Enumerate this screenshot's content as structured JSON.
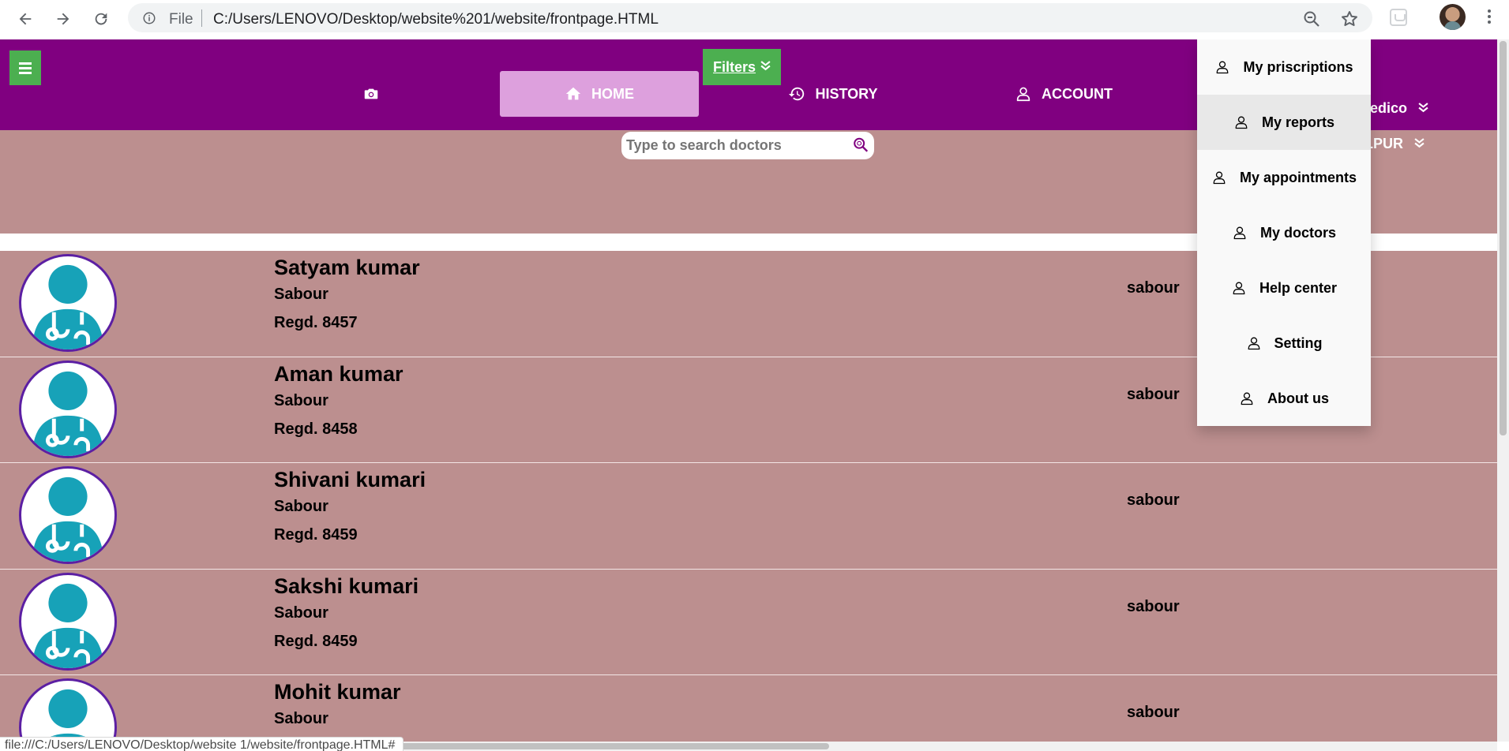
{
  "browser": {
    "scheme_label": "File",
    "url": "C:/Users/LENOVO/Desktop/website%201/website/frontpage.HTML",
    "status_url": "file:///C:/Users/LENOVO/Desktop/website 1/website/frontpage.HTML#",
    "icons": [
      "back-arrow-icon",
      "forward-arrow-icon",
      "reload-icon",
      "info-icon",
      "zoom-out-icon",
      "star-icon",
      "extension-icon",
      "avatar",
      "more-vert-icon"
    ]
  },
  "header": {
    "filters_label": "Filters",
    "nav": {
      "camera_icon": "camera-icon",
      "home_label": "HOME",
      "history_label": "HISTORY",
      "account_label": "ACCOUNT"
    },
    "side_medico": "edico",
    "side_city": "LPUR",
    "colors": {
      "bar": "#800080",
      "home_active": "#dda0dd",
      "green": "#4caf50"
    }
  },
  "search": {
    "placeholder": "Type to search doctors",
    "value": ""
  },
  "doctors": [
    {
      "name": "Satyam kumar",
      "place": "Sabour",
      "regd": "Regd. 8457",
      "location": "sabour"
    },
    {
      "name": "Aman kumar",
      "place": "Sabour",
      "regd": "Regd. 8458",
      "location": "sabour"
    },
    {
      "name": "Shivani kumari",
      "place": "Sabour",
      "regd": "Regd. 8459",
      "location": "sabour"
    },
    {
      "name": "Sakshi kumari",
      "place": "Sabour",
      "regd": "Regd. 8459",
      "location": "sabour"
    },
    {
      "name": "Mohit kumar",
      "place": "Sabour",
      "regd": "",
      "location": "sabour"
    }
  ],
  "account_menu": {
    "items": [
      {
        "label": "My priscriptions",
        "icon": "user-icon"
      },
      {
        "label": "My reports",
        "icon": "user-icon",
        "hovered": true
      },
      {
        "label": "My appointments",
        "icon": "user-icon"
      },
      {
        "label": "My doctors",
        "icon": "user-icon"
      },
      {
        "label": "Help center",
        "icon": "user-icon"
      },
      {
        "label": "Setting",
        "icon": "user-icon"
      },
      {
        "label": "About us",
        "icon": "user-icon"
      }
    ]
  },
  "colors": {
    "list_bg": "#bc8f8f",
    "avatar_border": "#5c1fa3",
    "avatar_figure": "#17a2b8"
  }
}
